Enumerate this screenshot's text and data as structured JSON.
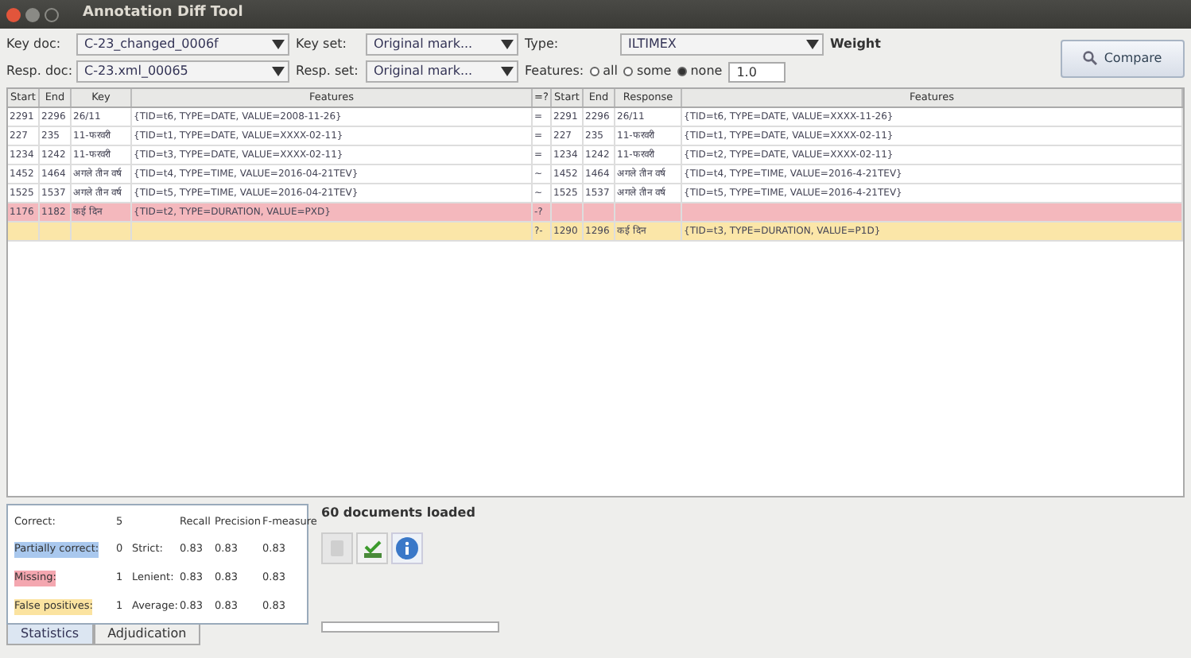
{
  "window": {
    "title": "Annotation Diff Tool"
  },
  "controls": {
    "key_doc_label": "Key doc:",
    "key_doc": "C-23_changed_0006f",
    "key_set_label": "Key set:",
    "key_set": "Original mark...",
    "type_label": "Type:",
    "type": "ILTIMEX",
    "weight_label": "Weight",
    "resp_doc_label": "Resp. doc:",
    "resp_doc": "C-23.xml_00065",
    "resp_set_label": "Resp. set:",
    "resp_set": "Original mark...",
    "features_label": "Features:",
    "feature_options": [
      {
        "label": "all",
        "selected": false
      },
      {
        "label": "some",
        "selected": false
      },
      {
        "label": "none",
        "selected": true
      }
    ],
    "weight": "1.0",
    "compare_button": "Compare"
  },
  "table": {
    "columns": [
      "Start",
      "End",
      "Key",
      "Features",
      "=?",
      "Start",
      "End",
      "Response",
      "Features"
    ],
    "rows": [
      {
        "kind": "match",
        "cells": [
          "2291",
          "2296",
          "26/11",
          "{TID=t6, TYPE=DATE, VALUE=2008-11-26}",
          "=",
          "2291",
          "2296",
          "26/11",
          "{TID=t6, TYPE=DATE, VALUE=XXXX-11-26}"
        ]
      },
      {
        "kind": "match",
        "cells": [
          "227",
          "235",
          "11-फरवरी",
          "{TID=t1, TYPE=DATE, VALUE=XXXX-02-11}",
          "=",
          "227",
          "235",
          "11-फरवरी",
          "{TID=t1, TYPE=DATE, VALUE=XXXX-02-11}"
        ]
      },
      {
        "kind": "match",
        "cells": [
          "1234",
          "1242",
          "11-फरवरी",
          "{TID=t3, TYPE=DATE, VALUE=XXXX-02-11}",
          "=",
          "1234",
          "1242",
          "11-फरवरी",
          "{TID=t2, TYPE=DATE, VALUE=XXXX-02-11}"
        ]
      },
      {
        "kind": "match",
        "cells": [
          "1452",
          "1464",
          "अगले तीन वर्ष",
          "{TID=t4, TYPE=TIME, VALUE=2016-04-21TEV}",
          "~",
          "1452",
          "1464",
          "अगले तीन वर्ष",
          "{TID=t4, TYPE=TIME, VALUE=2016-4-21TEV}"
        ]
      },
      {
        "kind": "match",
        "cells": [
          "1525",
          "1537",
          "अगले तीन वर्ष",
          "{TID=t5, TYPE=TIME, VALUE=2016-04-21TEV}",
          "~",
          "1525",
          "1537",
          "अगले तीन वर्ष",
          "{TID=t5, TYPE=TIME, VALUE=2016-4-21TEV}"
        ]
      },
      {
        "kind": "missing",
        "cells": [
          "1176",
          "1182",
          "कई दिन",
          "{TID=t2, TYPE=DURATION, VALUE=PXD}",
          "-?",
          "",
          "",
          "",
          ""
        ]
      },
      {
        "kind": "false_positive",
        "cells": [
          "",
          "",
          "",
          "",
          "?-",
          "1290",
          "1296",
          "कई दिन",
          "{TID=t3, TYPE=DURATION, VALUE=P1D}"
        ]
      }
    ]
  },
  "statistics": {
    "counts": [
      {
        "kind": "correct",
        "label": "Correct:",
        "value": "5"
      },
      {
        "kind": "partial",
        "label": "Partially correct:",
        "value": "0"
      },
      {
        "kind": "missing",
        "label": "Missing:",
        "value": "1"
      },
      {
        "kind": "false_positive",
        "label": "False positives:",
        "value": "1"
      }
    ],
    "headers": [
      "Recall",
      "Precision",
      "F-measure"
    ],
    "measures": [
      {
        "label": "Strict:",
        "values": [
          "0.83",
          "0.83",
          "0.83"
        ]
      },
      {
        "label": "Lenient:",
        "values": [
          "0.83",
          "0.83",
          "0.83"
        ]
      },
      {
        "label": "Average:",
        "values": [
          "0.83",
          "0.83",
          "0.83"
        ]
      }
    ]
  },
  "status": "60 documents loaded",
  "tabs": [
    {
      "label": "Statistics",
      "selected": true
    },
    {
      "label": "Adjudication",
      "selected": false
    }
  ]
}
